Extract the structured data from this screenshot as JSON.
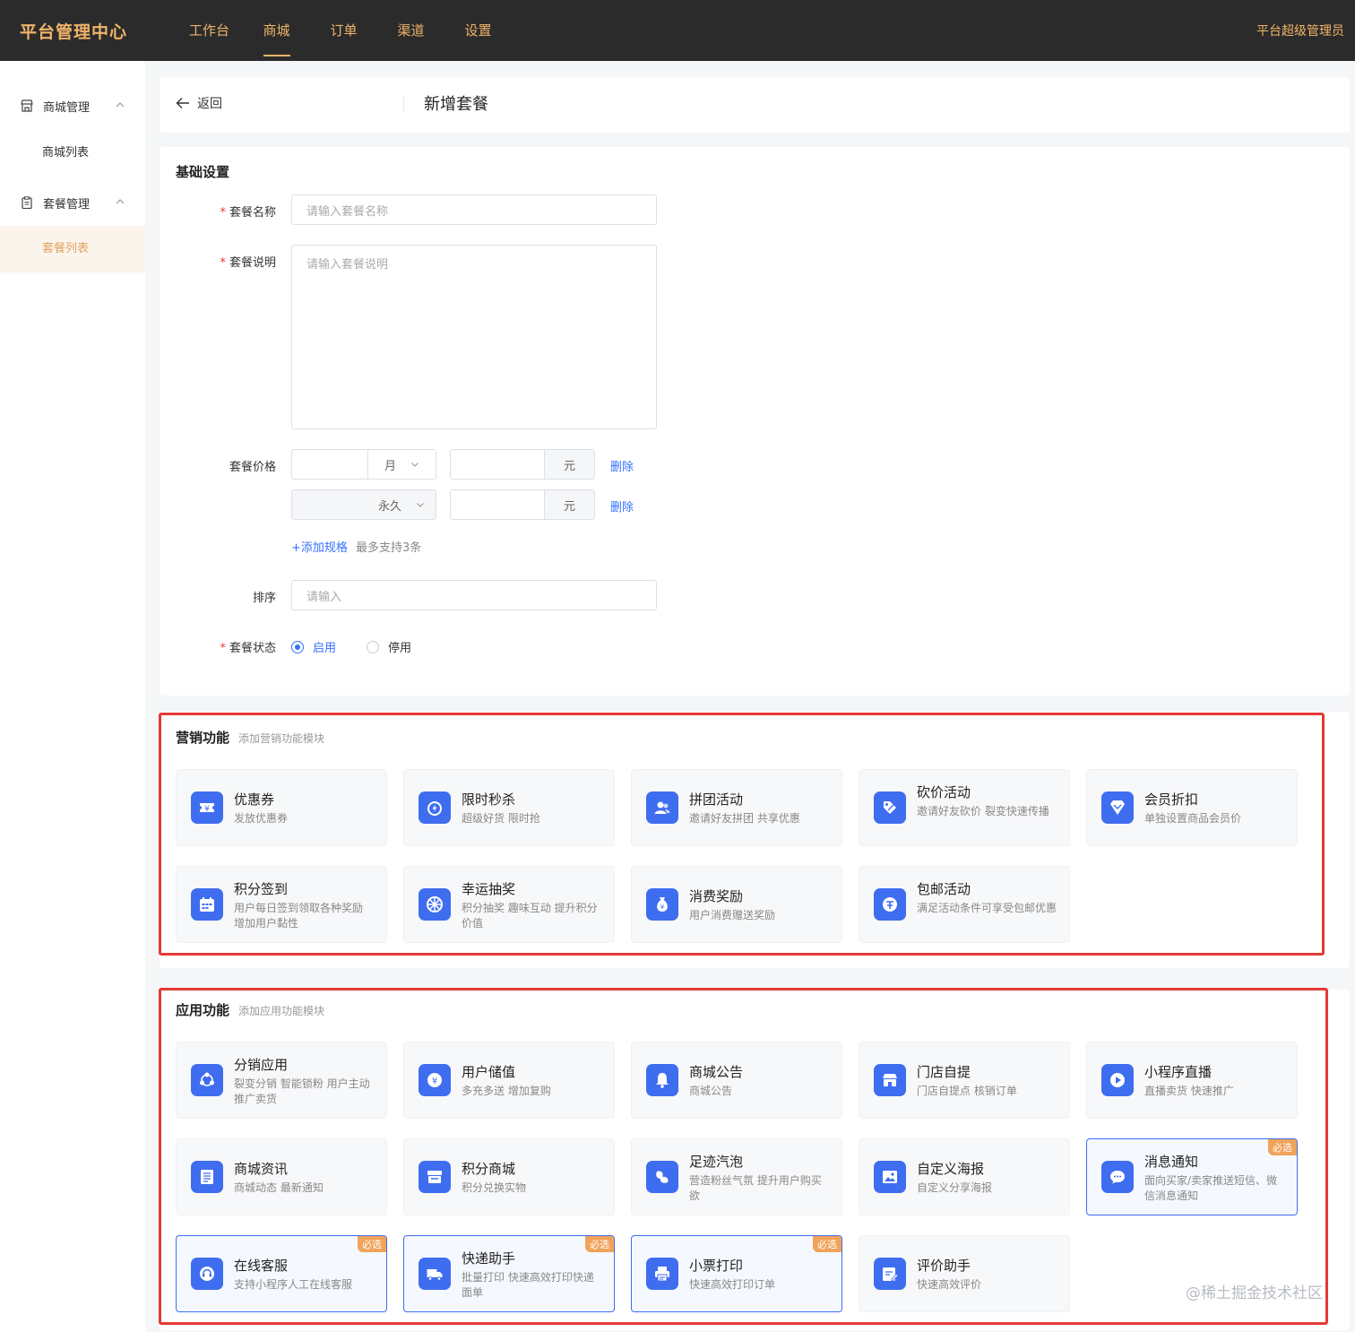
{
  "header": {
    "brand": "平台管理中心",
    "nav": [
      {
        "label": "工作台",
        "active": false
      },
      {
        "label": "商城",
        "active": true
      },
      {
        "label": "订单",
        "active": false
      },
      {
        "label": "渠道",
        "active": false
      },
      {
        "label": "设置",
        "active": false
      }
    ],
    "user": "平台超级管理员"
  },
  "sidebar": {
    "groups": [
      {
        "label": "商城管理",
        "icon": "store-icon",
        "items": [
          {
            "label": "商城列表",
            "active": false
          }
        ]
      },
      {
        "label": "套餐管理",
        "icon": "clipboard-icon",
        "items": [
          {
            "label": "套餐列表",
            "active": true
          }
        ]
      }
    ]
  },
  "page": {
    "back_label": "返回",
    "title": "新增套餐"
  },
  "basic": {
    "title": "基础设置",
    "name": {
      "label": "套餐名称",
      "placeholder": "请输入套餐名称",
      "required": true
    },
    "desc": {
      "label": "套餐说明",
      "placeholder": "请输入套餐说明",
      "required": true
    },
    "price": {
      "label": "套餐价格",
      "rows": [
        {
          "period": "月",
          "unit": "元",
          "delete": "删除",
          "disabled": false
        },
        {
          "period": "永久",
          "unit": "元",
          "delete": "删除",
          "disabled": true
        }
      ],
      "add_label": "+添加规格",
      "add_hint": "最多支持3条"
    },
    "sort": {
      "label": "排序",
      "placeholder": "请输入"
    },
    "status": {
      "label": "套餐状态",
      "required": true,
      "options": [
        {
          "label": "启用",
          "checked": true
        },
        {
          "label": "停用",
          "checked": false
        }
      ]
    }
  },
  "marketing": {
    "title": "营销功能",
    "subtitle": "添加营销功能模块",
    "cards": [
      {
        "title": "优惠券",
        "desc": "发放优惠券",
        "icon": "coupon-icon"
      },
      {
        "title": "限时秒杀",
        "desc": "超级好货 限时抢",
        "icon": "flash-sale-icon"
      },
      {
        "title": "拼团活动",
        "desc": "邀请好友拼团 共享优惠",
        "icon": "group-buy-icon"
      },
      {
        "title": "砍价活动",
        "desc": "邀请好友砍价 裂变快速传播",
        "icon": "bargain-icon"
      },
      {
        "title": "会员折扣",
        "desc": "单独设置商品会员价",
        "icon": "member-discount-icon"
      },
      {
        "title": "积分签到",
        "desc": "用户每日签到领取各种奖励 增加用户黏性",
        "icon": "checkin-icon"
      },
      {
        "title": "幸运抽奖",
        "desc": "积分抽奖 趣味互动 提升积分价值",
        "icon": "lottery-icon"
      },
      {
        "title": "消费奖励",
        "desc": "用户消费赠送奖励",
        "icon": "reward-icon"
      },
      {
        "title": "包邮活动",
        "desc": "满足活动条件可享受包邮优惠",
        "icon": "free-shipping-icon"
      }
    ]
  },
  "application": {
    "title": "应用功能",
    "subtitle": "添加应用功能模块",
    "cards": [
      {
        "title": "分销应用",
        "desc": "裂变分销 智能锁粉 用户主动推广卖货",
        "icon": "distribution-icon",
        "required": false
      },
      {
        "title": "用户储值",
        "desc": "多充多送 增加复购",
        "icon": "recharge-icon",
        "required": false
      },
      {
        "title": "商城公告",
        "desc": "商城公告",
        "icon": "bell-icon",
        "required": false
      },
      {
        "title": "门店自提",
        "desc": "门店自提点 核销订单",
        "icon": "store-pickup-icon",
        "required": false
      },
      {
        "title": "小程序直播",
        "desc": "直播卖货 快速推广",
        "icon": "live-icon",
        "required": false
      },
      {
        "title": "商城资讯",
        "desc": "商城动态 最新通知",
        "icon": "news-icon",
        "required": false
      },
      {
        "title": "积分商城",
        "desc": "积分兑换实物",
        "icon": "points-mall-icon",
        "required": false
      },
      {
        "title": "足迹汽泡",
        "desc": "营造粉丝气氛 提升用户购买欲",
        "icon": "footprint-icon",
        "required": false
      },
      {
        "title": "自定义海报",
        "desc": "自定义分享海报",
        "icon": "poster-icon",
        "required": false
      },
      {
        "title": "消息通知",
        "desc": "面向买家/卖家推送短信、微信消息通知",
        "icon": "message-icon",
        "required": true
      },
      {
        "title": "在线客服",
        "desc": "支持小程序人工在线客服",
        "icon": "customer-service-icon",
        "required": true
      },
      {
        "title": "快递助手",
        "desc": "批量打印 快速高效打印快递面单",
        "icon": "express-icon",
        "required": true
      },
      {
        "title": "小票打印",
        "desc": "快速高效打印订单",
        "icon": "printer-icon",
        "required": true
      },
      {
        "title": "评价助手",
        "desc": "快速高效评价",
        "icon": "review-icon",
        "required": false
      }
    ],
    "badge_label": "必选"
  },
  "watermark": "@稀土掘金技术社区",
  "colors": {
    "topbar": "#2b2b2b",
    "brand": "#f0b46a",
    "primary": "#3370ff",
    "icon_bg": "#3f6df0",
    "badge": "#f0a35a",
    "highlight": "#e53935"
  }
}
